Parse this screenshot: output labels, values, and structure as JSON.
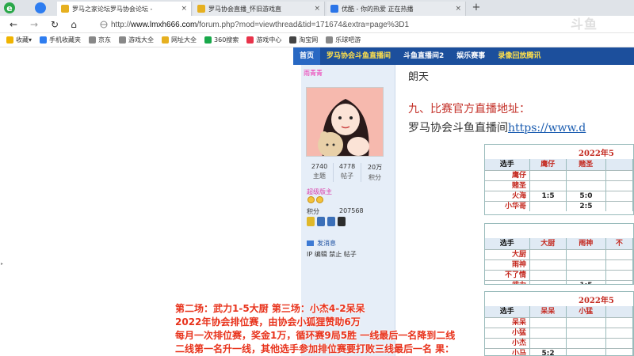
{
  "tabs": [
    {
      "title": "罗马之家论坛罗马协会论坛 -",
      "active": true,
      "color": "#e6b020"
    },
    {
      "title": "罗马协会直播_怀旧游戏直",
      "active": false,
      "color": "#e6b020"
    },
    {
      "title": "优酷 - 你的热爱 正在热播",
      "active": false,
      "color": "#2b75e8"
    }
  ],
  "tab_close": "×",
  "new_tab": "+",
  "address": {
    "scheme": "http://",
    "host": "www.lmxh666.com",
    "path": "/forum.php?mod=viewthread&tid=171674&extra=page%3D1"
  },
  "nav": {
    "back": "←",
    "forward": "→",
    "reload": "↻",
    "home": "⌂"
  },
  "bookmarks": [
    {
      "label": "收藏",
      "color": "#f0b400",
      "dropdown": "▾"
    },
    {
      "label": "手机收藏夹",
      "color": "#2e7df0"
    },
    {
      "label": "京东",
      "color": "#888888"
    },
    {
      "label": "游戏大全",
      "color": "#888888"
    },
    {
      "label": "网址大全",
      "color": "#e6b020"
    },
    {
      "label": "360搜索",
      "color": "#19a84a"
    },
    {
      "label": "游戏中心",
      "color": "#e8334a"
    },
    {
      "label": "淘宝网",
      "color": "#444444"
    },
    {
      "label": "乐球吧游",
      "color": "#888888"
    }
  ],
  "forum_nav": [
    "首页",
    "罗马协会斗鱼直播间",
    "斗鱼直播间2",
    "娱乐赛事",
    "录像回放腾讯"
  ],
  "user": {
    "name": "雨青青",
    "stats": [
      {
        "value": "2740",
        "label": "主题"
      },
      {
        "value": "4778",
        "label": "帖子"
      },
      {
        "value": "20万",
        "label": "积分"
      }
    ],
    "rank": "超级版主",
    "points_label": "积分",
    "points_value": "207568",
    "send_msg": "发消息",
    "ops": "IP 编辑 禁止 帖子"
  },
  "post": {
    "line1": "朗天",
    "line2": "九、比赛官方直播地址：",
    "line3_text": "罗马协会斗鱼直播间",
    "line3_link": "https://www.d"
  },
  "tables": [
    {
      "title": "2022年5",
      "header": [
        "选手",
        "鹰仔",
        "赌圣",
        ""
      ],
      "rows": [
        [
          "鹰仔",
          "",
          "",
          ""
        ],
        [
          "赌圣",
          "",
          "",
          ""
        ],
        [
          "火海",
          "1:5",
          "5:0",
          ""
        ],
        [
          "小华哥",
          "",
          "2:5",
          ""
        ]
      ]
    },
    {
      "title": "",
      "header": [
        "选手",
        "大厨",
        "雨神",
        "不"
      ],
      "rows": [
        [
          "大厨",
          "",
          "",
          ""
        ],
        [
          "雨神",
          "",
          "",
          ""
        ],
        [
          "不了情",
          "",
          "",
          ""
        ],
        [
          "武力",
          "",
          "1:5",
          ""
        ]
      ]
    },
    {
      "title": "2022年5",
      "header": [
        "选手",
        "呆呆",
        "小猛",
        ""
      ],
      "rows": [
        [
          "呆呆",
          "",
          "",
          ""
        ],
        [
          "小猛",
          "",
          "",
          ""
        ],
        [
          "小杰",
          "",
          "",
          ""
        ],
        [
          "小马",
          "5:2",
          "",
          ""
        ]
      ]
    }
  ],
  "subtitles": [
    "第二场：武力1-5大厨   第三场：小杰4-2呆呆",
    "2022年协会排位赛，由协会小狐狸赞助6万",
    "每月一次排位赛，奖金1万，循环赛9局5胜 一线最后一名降到二线",
    "二线第一名升一线，其他选手参加排位赛要打败三线最后一名 果："
  ],
  "watermark": "斗鱼"
}
